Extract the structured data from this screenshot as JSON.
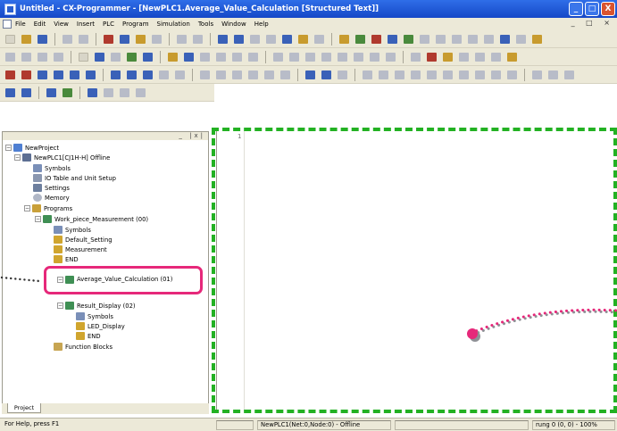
{
  "window": {
    "title": "Untitled - CX-Programmer - [NewPLC1.Average_Value_Calculation [Structured Text]]",
    "minimize": "_",
    "maximize": "□",
    "close": "X"
  },
  "menu": [
    "File",
    "Edit",
    "View",
    "Insert",
    "PLC",
    "Program",
    "Simulation",
    "Tools",
    "Window",
    "Help"
  ],
  "mdi_controls": "_ □ ×",
  "tree": {
    "header_controls": "_ |x|",
    "nodes": [
      {
        "label": "NewProject",
        "icon": "network-icon",
        "expander": "−"
      },
      {
        "label": "NewPLC1[CJ1H-H] Offline",
        "icon": "plc-icon",
        "expander": "−"
      },
      {
        "label": "Symbols",
        "icon": "symbols-icon"
      },
      {
        "label": "IO Table and Unit Setup",
        "icon": "io-table-icon"
      },
      {
        "label": "Settings",
        "icon": "settings-icon"
      },
      {
        "label": "Memory",
        "icon": "memory-icon"
      },
      {
        "label": "Programs",
        "icon": "programs-icon",
        "expander": "−"
      },
      {
        "label": "Work_piece_Measurement (00)",
        "icon": "task-icon",
        "expander": "−"
      },
      {
        "label": "Symbols",
        "icon": "symbols-icon"
      },
      {
        "label": "Default_Setting",
        "icon": "section-icon"
      },
      {
        "label": "Measurement",
        "icon": "section-icon"
      },
      {
        "label": "END",
        "icon": "section-icon"
      },
      {
        "label": "Average_Value_Calculation (01)",
        "icon": "st-task-icon",
        "expander": "−"
      },
      {
        "label": "Result_Display (02)",
        "icon": "task-icon",
        "expander": "−"
      },
      {
        "label": "Symbols",
        "icon": "symbols-icon"
      },
      {
        "label": "LED_Display",
        "icon": "section-icon"
      },
      {
        "label": "END",
        "icon": "section-icon"
      },
      {
        "label": "Function Blocks",
        "icon": "function-blocks-icon"
      }
    ]
  },
  "tabs": [
    {
      "label": "Project"
    }
  ],
  "editor": {
    "first_line_number": "1"
  },
  "status": {
    "help": "For Help, press F1",
    "connection": "NewPLC1(Net:0,Node:0) - Offline",
    "position": "rung 0 (0, 0) - 100%"
  },
  "colors": {
    "title_bar": "#1d52d0",
    "highlight_frame": "#e6287a",
    "editor_frame": "#23b123",
    "chrome": "#ece9d8"
  }
}
